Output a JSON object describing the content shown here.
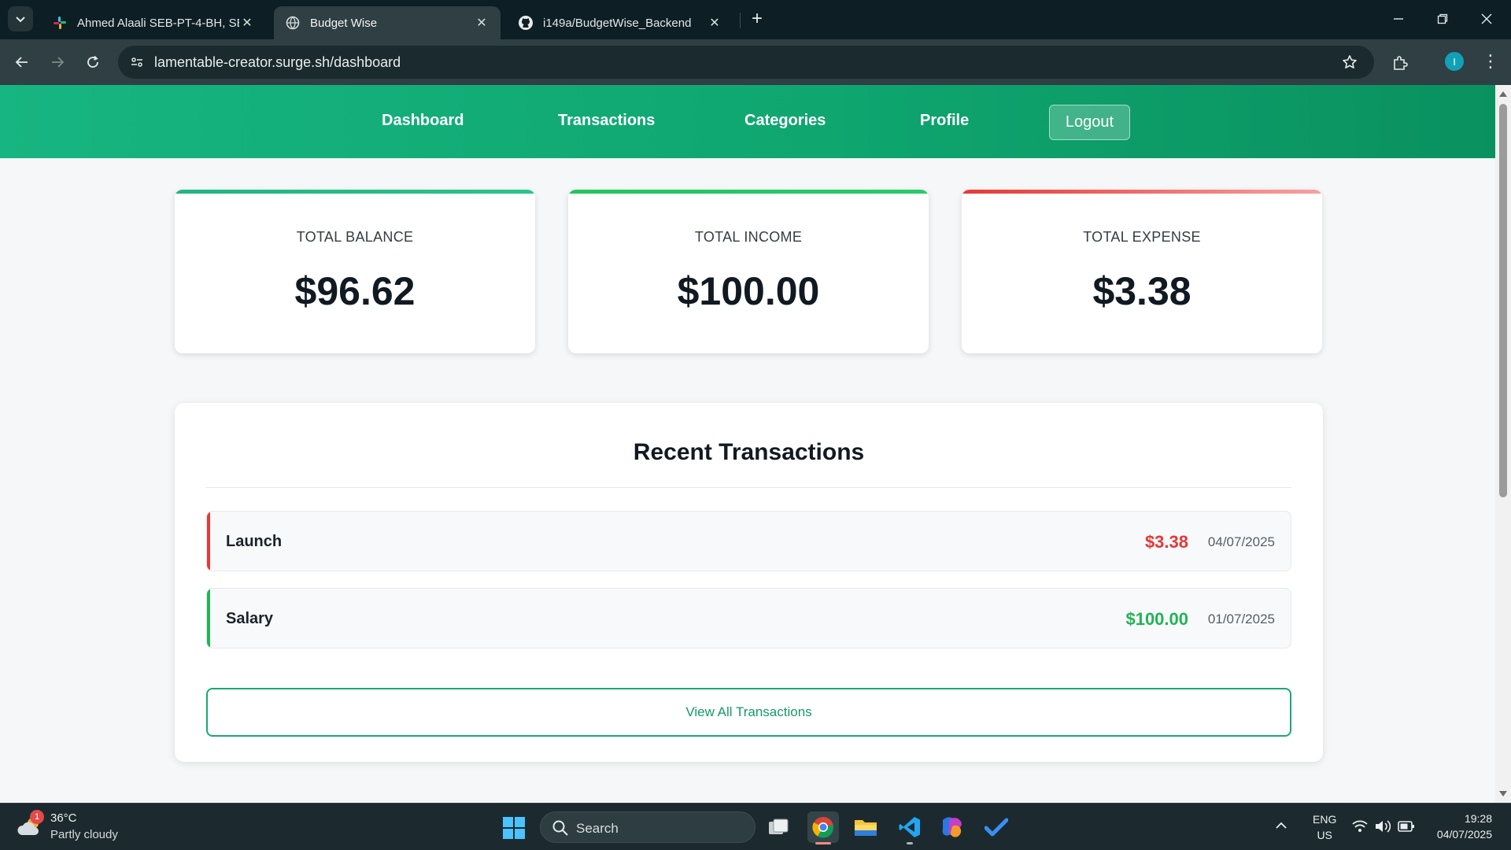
{
  "browser": {
    "tabs": [
      {
        "label": "Ahmed Alaali SEB-PT-4-BH, SEB",
        "icon": "slack-icon"
      },
      {
        "label": "Budget Wise",
        "icon": "globe-icon"
      },
      {
        "label": "i149a/BudgetWise_Backend",
        "icon": "github-icon"
      }
    ],
    "url": "lamentable-creator.surge.sh/dashboard",
    "profile_initial": "I"
  },
  "nav": {
    "links": [
      "Dashboard",
      "Transactions",
      "Categories",
      "Profile"
    ],
    "logout": "Logout",
    "color": "#12a877"
  },
  "summary": [
    {
      "label": "TOTAL BALANCE",
      "value": "$96.62",
      "accent": "#1fb57f"
    },
    {
      "label": "TOTAL INCOME",
      "value": "$100.00",
      "accent": "#22c55e"
    },
    {
      "label": "TOTAL EXPENSE",
      "value": "$3.38",
      "accent": "#ef4444"
    }
  ],
  "recent": {
    "title": "Recent Transactions",
    "items": [
      {
        "name": "Launch",
        "amount": "$3.38",
        "date": "04/07/2025",
        "type": "expense",
        "color": "#e53935"
      },
      {
        "name": "Salary",
        "amount": "$100.00",
        "date": "01/07/2025",
        "type": "income",
        "color": "#21b455"
      }
    ],
    "view_all": "View All Transactions"
  },
  "taskbar": {
    "weather_temp": "36°C",
    "weather_cond": "Partly cloudy",
    "weather_badge": "1",
    "search": "Search",
    "lang_1": "ENG",
    "lang_2": "US",
    "time": "19:28",
    "date": "04/07/2025"
  }
}
